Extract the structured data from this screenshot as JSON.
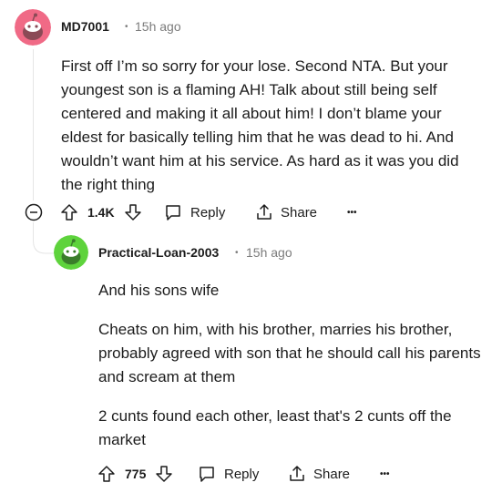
{
  "comment1": {
    "username": "MD7001",
    "separator": "•",
    "time": "15h ago",
    "avatar_color": "#f06a86",
    "text": "First off I’m so sorry for your lose. Second NTA. But your youngest son is a flaming AH! Talk about still being self centered and making it all about him! I don’t blame your eldest for basically telling him that he was dead to hi. And wouldn’t want him at his service. As hard as it was you did the right thing",
    "votes": "1.4K",
    "reply_label": "Reply",
    "share_label": "Share",
    "more_label": "•••"
  },
  "comment2": {
    "username": "Practical-Loan-2003",
    "separator": "•",
    "time": "15h ago",
    "avatar_color": "#5ed33c",
    "paragraphs": [
      "And his sons wife",
      "Cheats on him, with his brother, marries his brother, probably agreed with son that he should call his parents and scream at them",
      "2 cunts found each other, least that's 2 cunts off the market"
    ],
    "votes": "775",
    "reply_label": "Reply",
    "share_label": "Share",
    "more_label": "•••"
  },
  "icons": {
    "collapse": "collapse-minus-icon",
    "upvote": "upvote-arrow-icon",
    "downvote": "downvote-arrow-icon",
    "reply": "reply-bubble-icon",
    "share": "share-icon",
    "more": "more-options-icon"
  }
}
